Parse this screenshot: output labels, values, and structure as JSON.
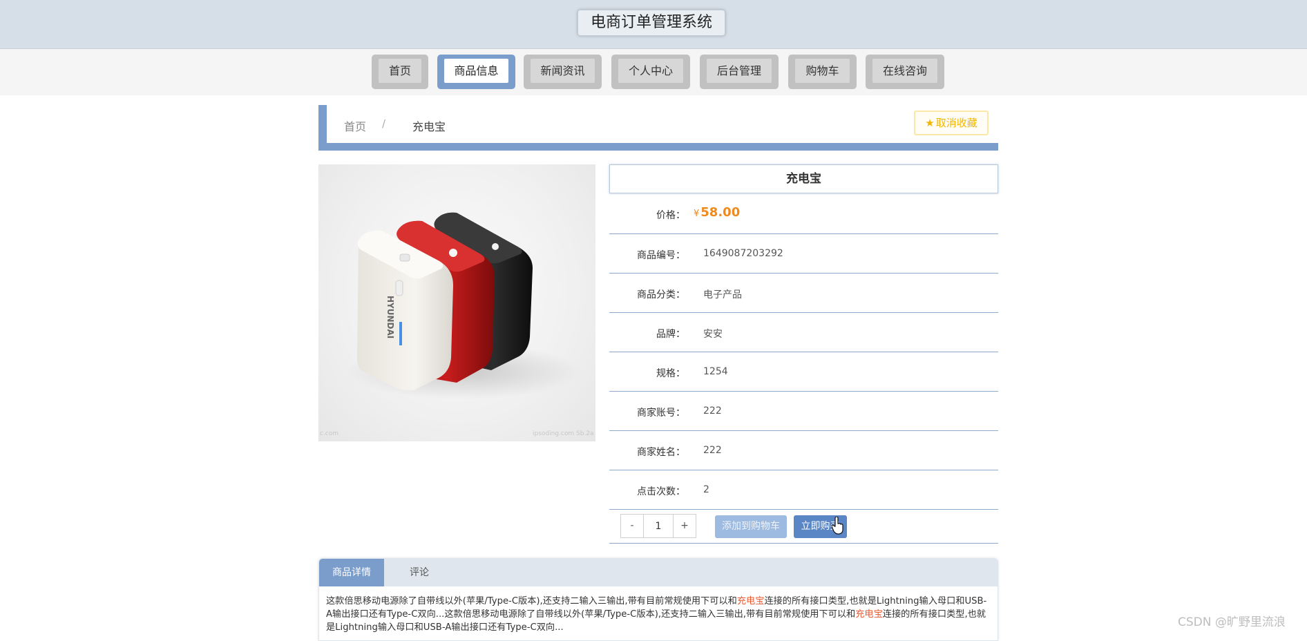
{
  "header": {
    "title": "电商订单管理系统"
  },
  "nav": {
    "items": [
      "首页",
      "商品信息",
      "新闻资讯",
      "个人中心",
      "后台管理",
      "购物车",
      "在线咨询"
    ],
    "active": "商品信息"
  },
  "breadcrumb": {
    "home": "首页",
    "separator": "/",
    "current": "充电宝",
    "favorite_label": "取消收藏"
  },
  "product": {
    "name": "充电宝",
    "currency_symbol": "¥",
    "price": "58.00",
    "price_label": "价格：",
    "fields": [
      {
        "label": "商品编号：",
        "value": "1649087203292"
      },
      {
        "label": "商品分类：",
        "value": "电子产品"
      },
      {
        "label": "品牌：",
        "value": "安安"
      },
      {
        "label": "规格：",
        "value": "1254"
      },
      {
        "label": "商家账号：",
        "value": "222"
      },
      {
        "label": "商家姓名：",
        "value": "222"
      },
      {
        "label": "点击次数：",
        "value": "2"
      }
    ],
    "quantity": "1",
    "minus_label": "-",
    "plus_label": "+",
    "add_to_cart_label": "添加到购物车",
    "buy_now_label": "立即购买",
    "image_text": {
      "brand": "HYUNDAI",
      "corner_left": "c.com",
      "corner_right": "ipsoding.com  Sb.2a"
    }
  },
  "detail_tabs": {
    "tabs": [
      "商品详情",
      "评论"
    ],
    "active": "商品详情",
    "description": {
      "part1": "这款倍思移动电源除了自带线以外(苹果/Type-C版本),还支持二输入三输出,带有目前常规使用下可以和",
      "keyword1": "充电宝",
      "part2": "连接的所有接口类型,也就是Lightning输入母口和USB-A输出接口还有Type-C双向...这款倍思移动电源除了自带线以外(苹果/Type-C版本),还支持二输入三输出,带有目前常规使用下可以和",
      "keyword2": "充电宝",
      "part3": "连接的所有接口类型,也就是Lightning输入母口和USB-A输出接口还有Type-C双向..."
    }
  },
  "watermark": "CSDN @旷野里流浪",
  "colors": {
    "header_bg": "#d6dfe8",
    "accent_blue": "#7b9dcc",
    "price_orange": "#f08a1d",
    "favorite_yellow": "#f2b600",
    "highlight_red": "#e8582f",
    "buy_button": "#5a86c6",
    "cart_button": "#9dbae0"
  },
  "icons": {
    "favorite": "star-icon",
    "pointer": "hand-pointer-icon"
  }
}
